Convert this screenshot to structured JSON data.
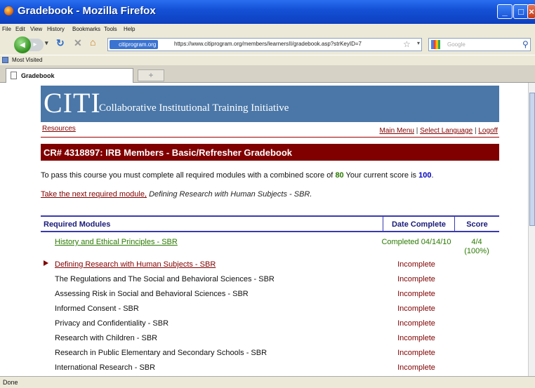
{
  "window": {
    "title": "Gradebook - Mozilla Firefox"
  },
  "menu": [
    "File",
    "Edit",
    "View",
    "History",
    "Bookmarks",
    "Tools",
    "Help"
  ],
  "nav": {
    "site_label": "citiprogram.org",
    "url": "https://www.citiprogram.org/members/learnersII/gradebook.asp?strKeyID=7",
    "search_placeholder": "Google"
  },
  "bookmarks": {
    "most_visited": "Most Visited"
  },
  "tab": {
    "label": "Gradebook",
    "new_tab": "+"
  },
  "banner": {
    "logo": "CITI",
    "subtitle": "Collaborative Institutional Training Initiative"
  },
  "links": {
    "resources": "Resources",
    "main_menu": "Main Menu",
    "select_language": "Select Language",
    "logoff": "Logoff",
    "sep": "|"
  },
  "course": {
    "title": "CR# 4318897: IRB Members - Basic/Refresher Gradebook"
  },
  "pass": {
    "prefix": "To pass this course you must complete all required modules with a combined score of",
    "required_score": "80",
    "middle": "Your current score is",
    "current_score": "100",
    "suffix": "."
  },
  "next": {
    "link": "Take the next required module,",
    "module": "Defining Research with Human Subjects - SBR."
  },
  "table": {
    "headers": {
      "module": "Required Modules",
      "date": "Date Complete",
      "score": "Score"
    },
    "rows": [
      {
        "name": "History and Ethical Principles - SBR",
        "date": "Completed 04/14/10",
        "score": "4/4",
        "pct": "(100%)"
      },
      {
        "name": "Defining Research with Human Subjects - SBR",
        "date": "Incomplete"
      },
      {
        "name": "The Regulations and The Social and Behavioral Sciences - SBR",
        "date": "Incomplete"
      },
      {
        "name": "Assessing Risk in Social and Behavioral Sciences - SBR",
        "date": "Incomplete"
      },
      {
        "name": "Informed Consent - SBR",
        "date": "Incomplete"
      },
      {
        "name": "Privacy and Confidentiality - SBR",
        "date": "Incomplete"
      },
      {
        "name": "Research with Children - SBR",
        "date": "Incomplete"
      },
      {
        "name": "Research in Public Elementary and Secondary Schools - SBR",
        "date": "Incomplete"
      },
      {
        "name": "International Research - SBR",
        "date": "Incomplete"
      }
    ]
  },
  "status": {
    "text": "Done"
  },
  "colors": {
    "banner": "#4a77a8",
    "header_red": "#800000",
    "green": "#2a7a00"
  }
}
